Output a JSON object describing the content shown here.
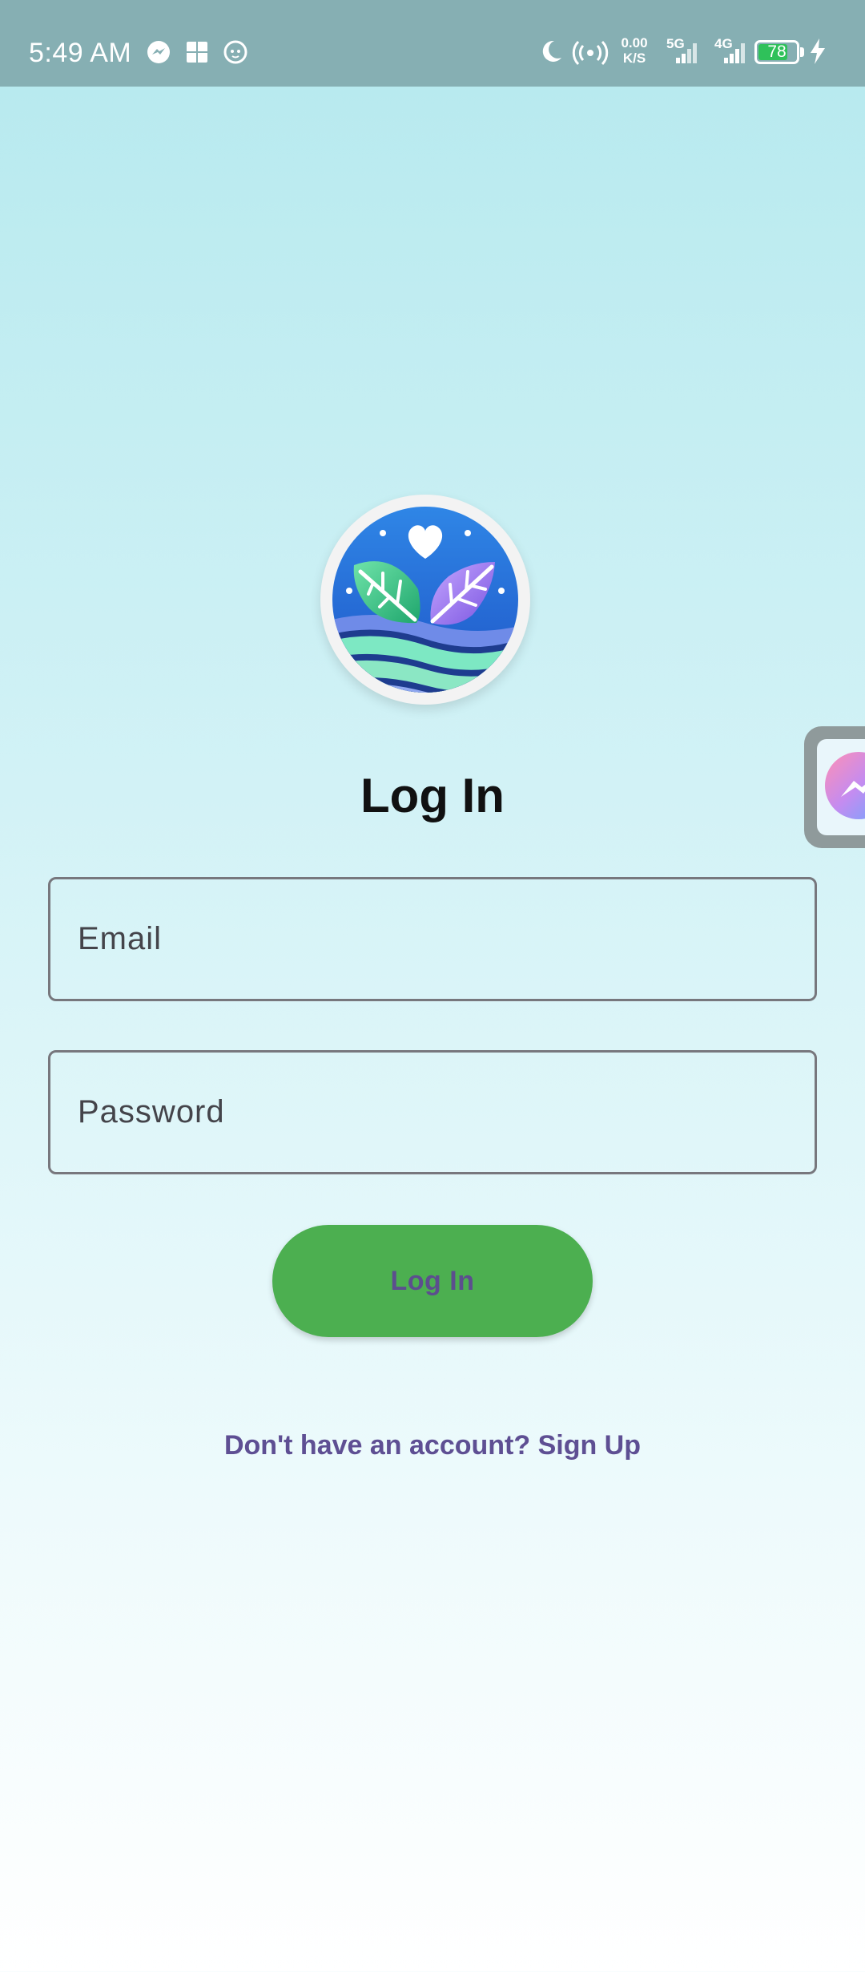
{
  "status_bar": {
    "time": "5:49 AM",
    "speed_value": "0.00",
    "speed_unit": "K/S",
    "net1": "5G",
    "net2": "4G",
    "battery_level": "78",
    "battery_color": "#2fc15a",
    "icons": [
      "messenger-icon",
      "gallery-icon",
      "cat-icon",
      "moon-icon",
      "hotspot-icon",
      "signal-5g-icon",
      "signal-4g-icon",
      "battery-icon",
      "charging-icon"
    ]
  },
  "app": {
    "title": "Log In",
    "email": {
      "placeholder": "Email",
      "value": ""
    },
    "password": {
      "placeholder": "Password",
      "value": ""
    },
    "login_button_label": "Log In",
    "signup_text": "Don't have an account? Sign Up",
    "accent_color": "#4caf50",
    "link_color": "#5e4f93"
  },
  "overlay": {
    "chat_head_icon": "messenger-chat-head-icon"
  }
}
